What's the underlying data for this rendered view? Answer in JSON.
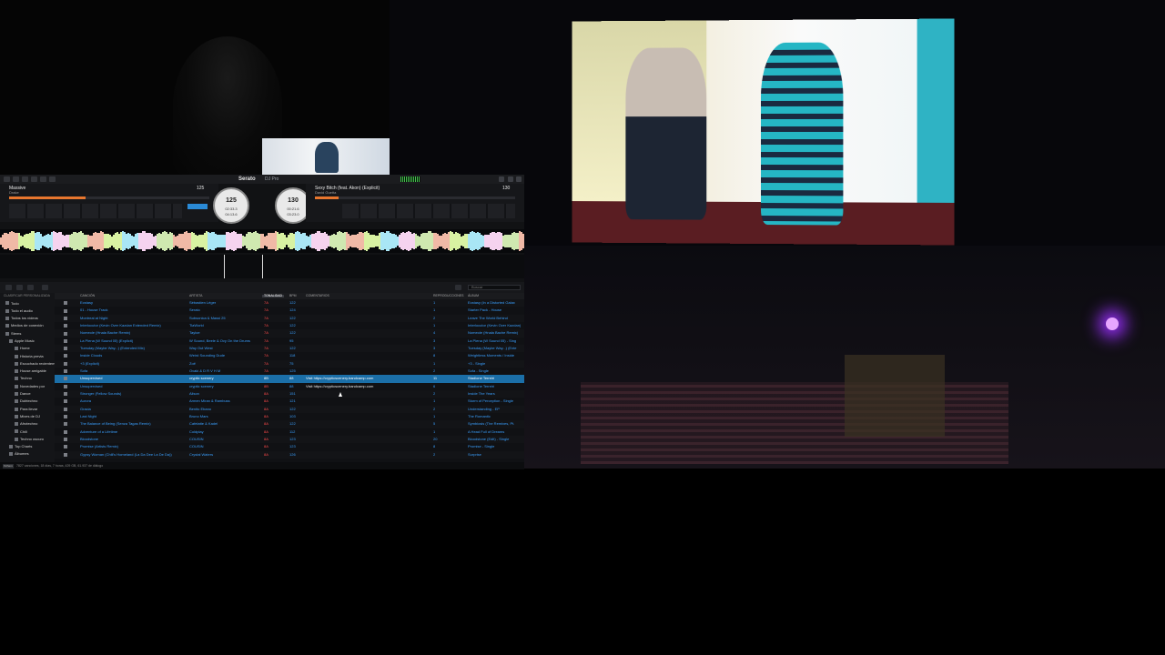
{
  "app": {
    "logo": "Serato",
    "plan": "DJ Pro"
  },
  "deck_left": {
    "title": "Massive",
    "artist": "Drake",
    "bpm": "125",
    "platter_bpm": "125",
    "platter_time1": "02:33.3",
    "platter_time2": "04:13.6",
    "progress": 0.38
  },
  "deck_right": {
    "title": "Sexy Bitch (feat. Akon) (Explicit)",
    "artist": "David Guetta",
    "bpm": "130",
    "platter_bpm": "130",
    "platter_time1": "00:21.6",
    "platter_time2": "03:23.0",
    "progress": 0.12
  },
  "library": {
    "search_placeholder": "Buscar",
    "columns": {
      "song": "CANCIÓN",
      "artist": "ARTISTA",
      "key": "TONALIDAD",
      "bpm": "BPM",
      "comment": "COMENTARIOS",
      "plays": "REPRODUCCIONES",
      "album": "ÁLBUM"
    },
    "tracks": [
      {
        "song": "Ecstasy",
        "artist": "Sébastien Léger",
        "key": "7A",
        "bpm": "122",
        "comment": "",
        "plays": "1",
        "album": "Ecstasy (In a Distorted Galax"
      },
      {
        "song": "01 - House Track",
        "artist": "Serato",
        "key": "7A",
        "bpm": "124",
        "comment": "",
        "plays": "1",
        "album": "Starter Pack - House"
      },
      {
        "song": "Montreal at Night",
        "artist": "Subsonica & Massi 25",
        "key": "7A",
        "bpm": "122",
        "comment": "",
        "plays": "2",
        "album": "Leave The World Behind"
      },
      {
        "song": "Interlocutor (Kevin Over Kazdan Extended Remix)",
        "artist": "TiaWorld",
        "key": "7A",
        "bpm": "122",
        "comment": "",
        "plays": "1",
        "album": "Interlocutor (Kevin Over Kazdan)"
      },
      {
        "song": "Nomeole (Hnala Bache Remix)",
        "artist": "Tayloe",
        "key": "7A",
        "bpm": "122",
        "comment": "",
        "plays": "4",
        "album": "Nomeole (Hnala Bache Remix)"
      },
      {
        "song": "La Plena (W Sound 05) (Explicit)",
        "artist": "W Sound, Beele & Ovy On the Drums",
        "key": "7A",
        "bpm": "95",
        "comment": "",
        "plays": "3",
        "album": "La Plena (W Sound 05) - Sing"
      },
      {
        "song": "Tuesday (Maybe Way...) (Extended Mix)",
        "artist": "Way Out West",
        "key": "7A",
        "bpm": "122",
        "comment": "",
        "plays": "3",
        "album": "Tuesday (Maybe Way...) (Exte"
      },
      {
        "song": "Inside Clouds",
        "artist": "Weird Sounding Dude",
        "key": "7A",
        "bpm": "118",
        "comment": "",
        "plays": "8",
        "album": "Weightless Moments / Inside"
      },
      {
        "song": "+3 (Explicit)",
        "artist": "Zoë",
        "key": "7A",
        "bpm": "75",
        "comment": "",
        "plays": "1",
        "album": "+3 - Single"
      },
      {
        "song": "Sofa",
        "artist": "Ovaki & D R V H M",
        "key": "7A",
        "bpm": "125",
        "comment": "",
        "plays": "2",
        "album": "Sofa - Single"
      },
      {
        "song": "Unsupervised",
        "artist": "cryptic scenery",
        "key": "8B",
        "bpm": "88",
        "comment": "Visit https://crypticscenery.bandcamp.com",
        "plays": "11",
        "album": "Stadione Terreiri"
      },
      {
        "song": "Unsupervised",
        "artist": "cryptic scenery",
        "key": "8B",
        "bpm": "88",
        "comment": "Visit https://crypticscenery.bandcamp.com",
        "plays": "6",
        "album": "Stadione Terreiri"
      },
      {
        "song": "Stronger (Fellow Sounds)",
        "artist": "Alison",
        "key": "8A",
        "bpm": "151",
        "comment": "",
        "plays": "2",
        "album": "Inside The Years"
      },
      {
        "song": "Aurora",
        "artist": "Armen Miran & Rambuss",
        "key": "8A",
        "bpm": "121",
        "comment": "",
        "plays": "1",
        "album": "Storm of Perception - Single"
      },
      {
        "song": "Gracia",
        "artist": "Benito Ebano",
        "key": "8A",
        "bpm": "122",
        "comment": "",
        "plays": "2",
        "album": "Understanding - EP"
      },
      {
        "song": "Last Night",
        "artist": "Bruno Mars",
        "key": "8A",
        "bpm": "103",
        "comment": "",
        "plays": "1",
        "album": "The Romantic"
      },
      {
        "song": "The Balance of Being (Senza Tagas Remix)",
        "artist": "Cafelatte & Kadel",
        "key": "8A",
        "bpm": "122",
        "comment": "",
        "plays": "5",
        "album": "Symbiosis (The Remixes, Pt."
      },
      {
        "song": "Adventure of a Lifetime",
        "artist": "Coldplay",
        "key": "8A",
        "bpm": "112",
        "comment": "",
        "plays": "1",
        "album": "A Head Full of Dreams"
      },
      {
        "song": "Bloodstone",
        "artist": "COUSIN",
        "key": "8A",
        "bpm": "123",
        "comment": "",
        "plays": "20",
        "album": "Bloodstone (Edit) - Single"
      },
      {
        "song": "Promise (Artists Remix)",
        "artist": "COUSIN",
        "key": "8A",
        "bpm": "123",
        "comment": "",
        "plays": "8",
        "album": "Promise - Single"
      },
      {
        "song": "Gypsy Woman (Chili's Homeland (La Da Dee La De Da))",
        "artist": "Crystal Waters",
        "key": "8A",
        "bpm": "126",
        "comment": "",
        "plays": "2",
        "album": "Surprise"
      }
    ]
  },
  "sidebar": {
    "header": "CLASIFICAR PERSONALIZADA",
    "items": [
      "Todo",
      "Todo el audio",
      "Todos los vídeos",
      "Medios de conexión",
      "Stems",
      "Apple Music",
      "Home",
      "Historia previa",
      "Escuchado recientemente",
      "House amigable",
      "Techno",
      "Novedades por",
      "Dance",
      "Dubtechno",
      "Para llevar",
      "Mixes de DJ",
      "Afrotechno",
      "Chill",
      "Techno oscuro",
      "Top Charts",
      "Álbumes"
    ]
  },
  "status_bar": {
    "button": "Fichero",
    "text": "7827 canciones, 18 días, 7 horas, 429 GB, 61.937 de diálogo"
  }
}
